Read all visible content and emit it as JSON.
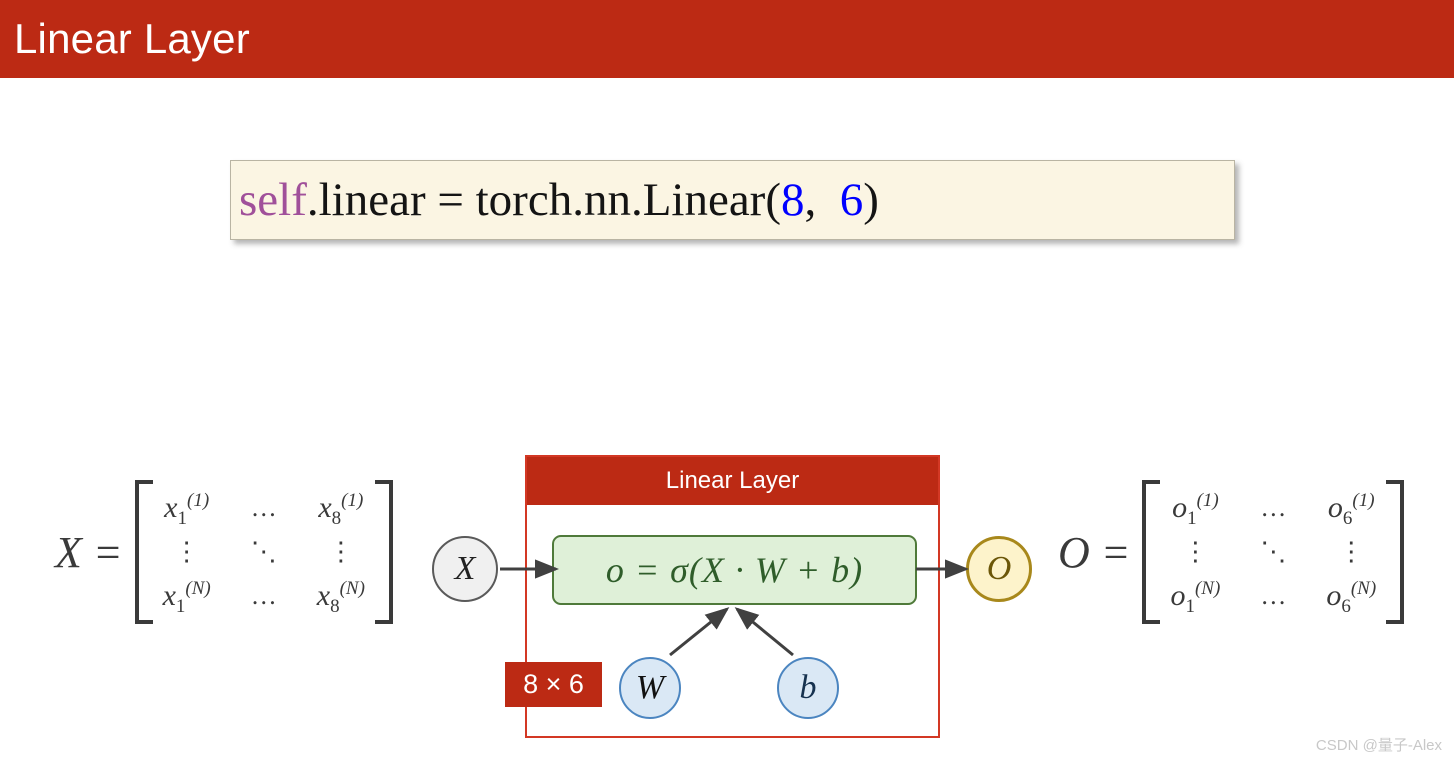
{
  "header": {
    "title": "Linear Layer",
    "background_color": "#bc2a14",
    "text_color": "#ffffff"
  },
  "code_block": {
    "full_text": "self.linear = torch.nn.Linear(8, 6)",
    "tokens": {
      "self": "self",
      "after_self": ".linear = torch.nn.Linear(",
      "arg_in": "8",
      "separator": ",  ",
      "arg_out": "6",
      "closing": ")"
    },
    "background_color": "#fbf5e3",
    "self_color": "#a0509a",
    "number_color": "#0000ff"
  },
  "input_matrix": {
    "name": "X",
    "equals": "=",
    "rows": [
      {
        "left_base": "x",
        "left_sub": "1",
        "left_sup": "(1)",
        "mid": "…",
        "right_base": "x",
        "right_sub": "8",
        "right_sup": "(1)"
      },
      {
        "left_base": "⋮",
        "left_sub": "",
        "left_sup": "",
        "mid": "⋱",
        "right_base": "⋮",
        "right_sub": "",
        "right_sup": ""
      },
      {
        "left_base": "x",
        "left_sub": "1",
        "left_sup": "(N)",
        "mid": "…",
        "right_base": "x",
        "right_sub": "8",
        "right_sup": "(N)"
      }
    ]
  },
  "output_matrix": {
    "name": "O",
    "equals": "=",
    "rows": [
      {
        "left_base": "o",
        "left_sub": "1",
        "left_sup": "(1)",
        "mid": "…",
        "right_base": "o",
        "right_sub": "6",
        "right_sup": "(1)"
      },
      {
        "left_base": "⋮",
        "left_sub": "",
        "left_sup": "",
        "mid": "⋱",
        "right_base": "⋮",
        "right_sub": "",
        "right_sup": ""
      },
      {
        "left_base": "o",
        "left_sub": "1",
        "left_sup": "(N)",
        "mid": "…",
        "right_base": "o",
        "right_sub": "6",
        "right_sup": "(N)"
      }
    ]
  },
  "diagram": {
    "box_title": "Linear Layer",
    "box_border_color": "#d33824",
    "formula": "o = σ(X · W + b)",
    "formula_bg": "#dff0d8",
    "formula_border": "#4f7a3a",
    "formula_text_color": "#2f5d2a",
    "shape_badge": "8 × 6",
    "shape_badge_color": "#bc2a14",
    "input_node": "X",
    "output_node": "O",
    "weight_node": "W",
    "bias_node": "b",
    "weight_node_fill": "#dae8f5",
    "weight_node_border": "#4b85c0",
    "output_node_fill": "#fdf3cb",
    "output_node_border": "#a8881b"
  },
  "watermark": {
    "text": "CSDN @量子-Alex"
  }
}
